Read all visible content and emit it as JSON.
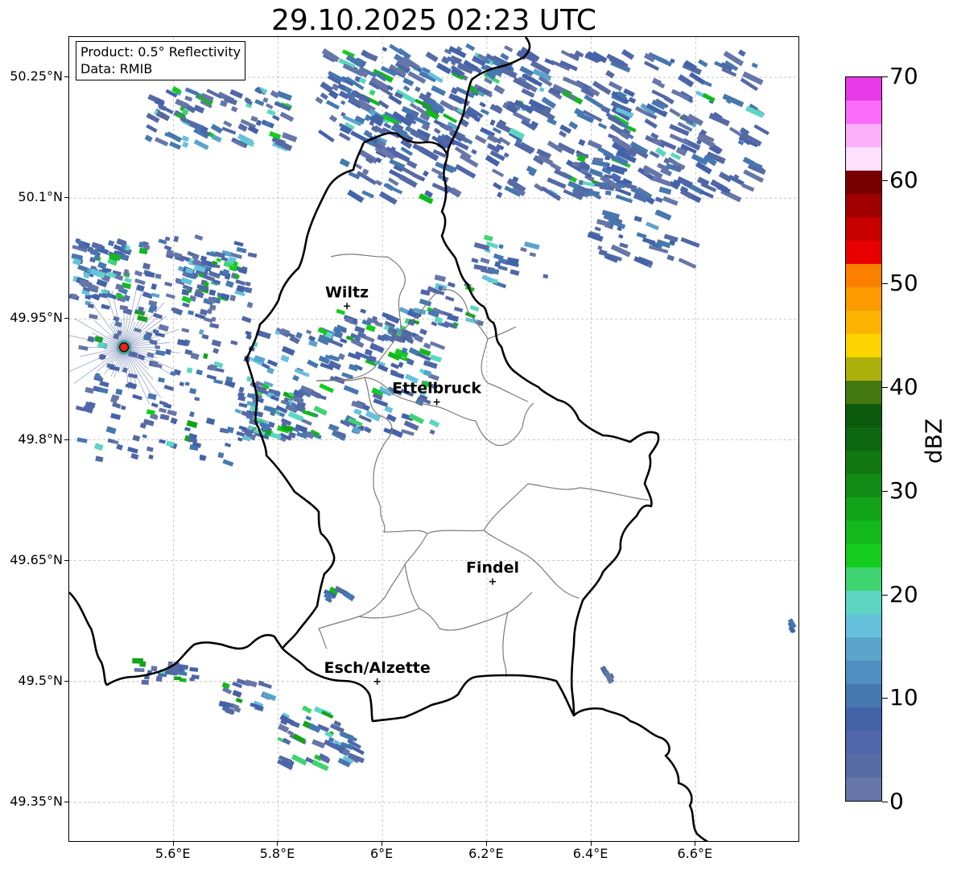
{
  "title": "29.10.2025 02:23 UTC",
  "info_box": {
    "product": "Product: 0.5° Reflectivity",
    "data": "Data: RMIB"
  },
  "extent": {
    "lon_min": 5.4,
    "lon_max": 6.8,
    "lat_min": 49.3,
    "lat_max": 50.3
  },
  "lat_ticks": [
    {
      "value": 50.25,
      "label": "50.25°N"
    },
    {
      "value": 50.1,
      "label": "50.1°N"
    },
    {
      "value": 49.95,
      "label": "49.95°N"
    },
    {
      "value": 49.8,
      "label": "49.8°N"
    },
    {
      "value": 49.65,
      "label": "49.65°N"
    },
    {
      "value": 49.5,
      "label": "49.5°N"
    },
    {
      "value": 49.35,
      "label": "49.35°N"
    }
  ],
  "lon_ticks": [
    {
      "value": 5.6,
      "label": "5.6°E"
    },
    {
      "value": 5.8,
      "label": "5.8°E"
    },
    {
      "value": 6.0,
      "label": "6°E"
    },
    {
      "value": 6.2,
      "label": "6.2°E"
    },
    {
      "value": 6.4,
      "label": "6.4°E"
    },
    {
      "value": 6.6,
      "label": "6.6°E"
    }
  ],
  "cities": [
    {
      "name": "Wiltz",
      "lon": 5.932,
      "lat": 49.966
    },
    {
      "name": "Ettelbruck",
      "lon": 6.104,
      "lat": 49.847
    },
    {
      "name": "Findel",
      "lon": 6.211,
      "lat": 49.624
    },
    {
      "name": "Esch/Alzette",
      "lon": 5.99,
      "lat": 49.5
    }
  ],
  "radar_site": {
    "lon": 5.505,
    "lat": 49.915,
    "color": "#e8221c"
  },
  "colorbar": {
    "unit": "dBZ",
    "min": 0,
    "max": 70,
    "ticks": [
      {
        "value": 0,
        "label": "0"
      },
      {
        "value": 10,
        "label": "10"
      },
      {
        "value": 20,
        "label": "20"
      },
      {
        "value": 30,
        "label": "30"
      },
      {
        "value": 40,
        "label": "40"
      },
      {
        "value": 50,
        "label": "50"
      },
      {
        "value": 60,
        "label": "60"
      },
      {
        "value": 70,
        "label": "70"
      }
    ],
    "colors": [
      "#6676a8",
      "#566aa4",
      "#4f66a8",
      "#4462a8",
      "#4678b0",
      "#4f8ec0",
      "#5aa4cc",
      "#66c2dc",
      "#5cd6c2",
      "#3ed470",
      "#14cc1e",
      "#12b81c",
      "#12a418",
      "#128c14",
      "#127812",
      "#0c6810",
      "#0c5a0c",
      "#447810",
      "#adb00a",
      "#fcd400",
      "#fcb400",
      "#fc9a00",
      "#fc8000",
      "#e80000",
      "#c80000",
      "#a00000",
      "#780000",
      "#fee0fe",
      "#fcb0fc",
      "#fc6cfc",
      "#e83ae8"
    ]
  }
}
